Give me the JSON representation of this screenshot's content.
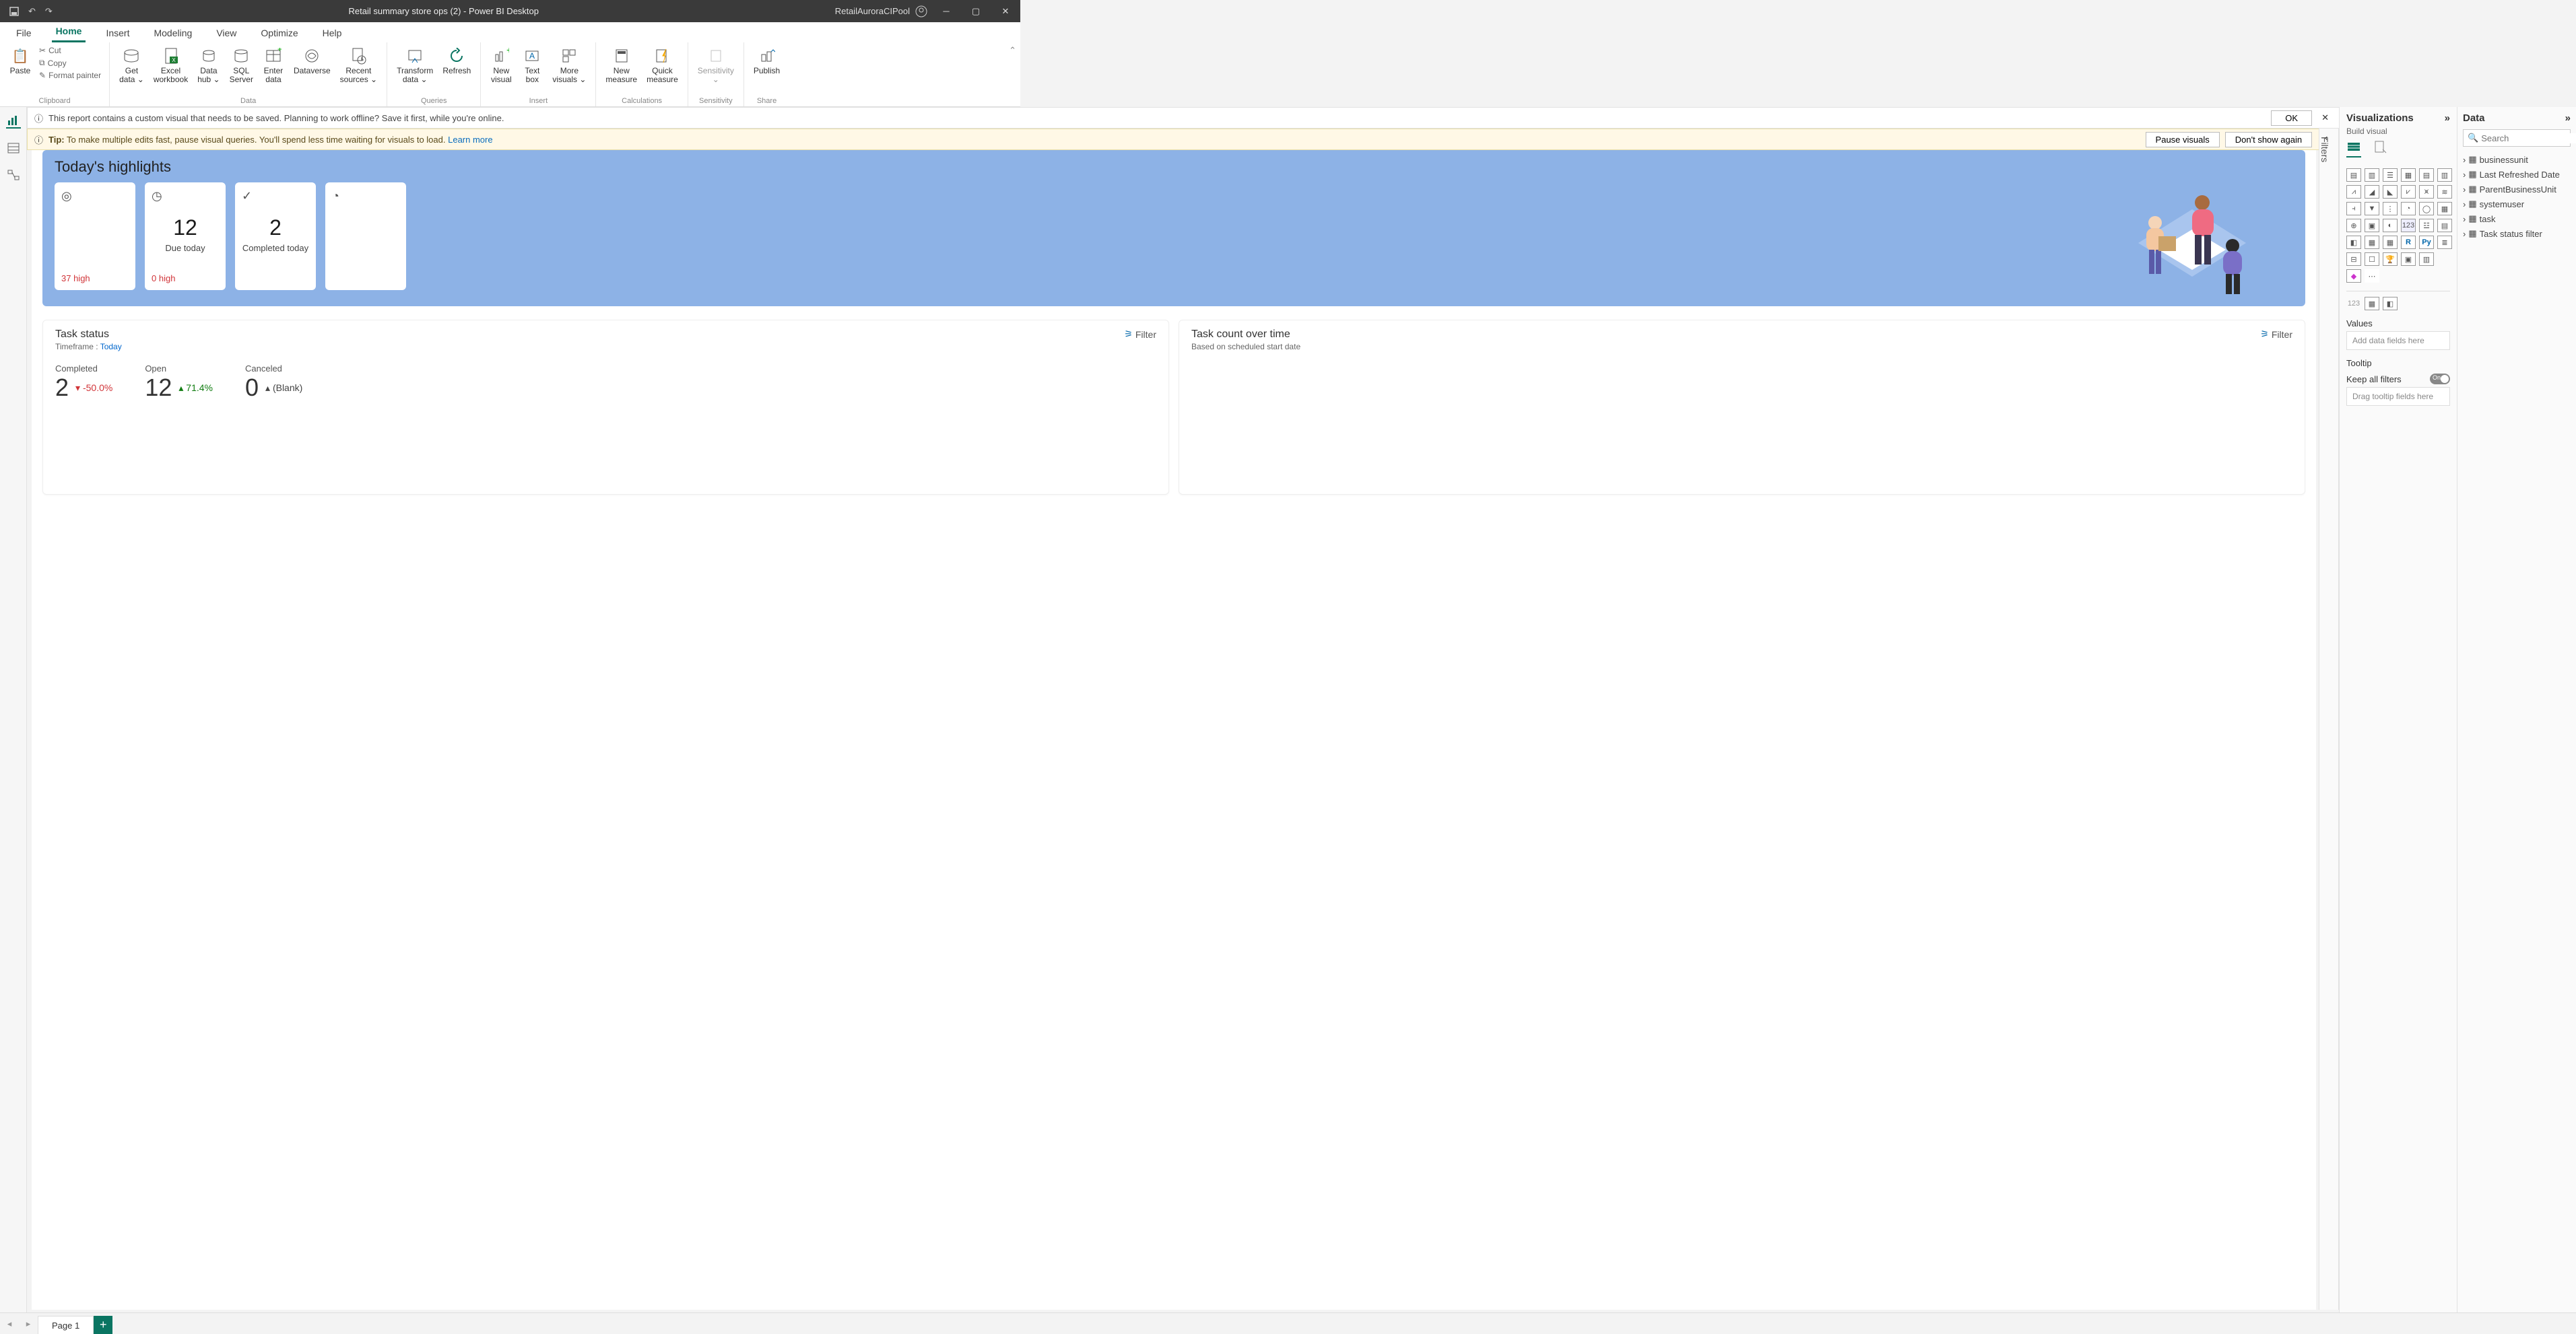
{
  "title": "Retail summary store ops (2) - Power BI Desktop",
  "username": "RetailAuroraCIPool",
  "menutabs": [
    "File",
    "Home",
    "Insert",
    "Modeling",
    "View",
    "Optimize",
    "Help"
  ],
  "activeMenu": 1,
  "ribbon": {
    "clipboard": {
      "label": "Clipboard",
      "paste": "Paste",
      "cut": "Cut",
      "copy": "Copy",
      "fmt": "Format painter"
    },
    "data": {
      "label": "Data",
      "b0": "Get\ndata ⌄",
      "b1": "Excel\nworkbook",
      "b2": "Data\nhub ⌄",
      "b3": "SQL\nServer",
      "b4": "Enter\ndata",
      "b5": "Dataverse",
      "b6": "Recent\nsources ⌄"
    },
    "queries": {
      "label": "Queries",
      "b0": "Transform\ndata ⌄",
      "b1": "Refresh"
    },
    "insert": {
      "label": "Insert",
      "b0": "New\nvisual",
      "b1": "Text\nbox",
      "b2": "More\nvisuals ⌄"
    },
    "calc": {
      "label": "Calculations",
      "b0": "New\nmeasure",
      "b1": "Quick\nmeasure"
    },
    "sens": {
      "label": "Sensitivity",
      "b0": "Sensitivity\n⌄"
    },
    "share": {
      "label": "Share",
      "b0": "Publish"
    }
  },
  "info1": {
    "msg": "This report contains a custom visual that needs to be saved. Planning to work offline? Save it first, while you're online.",
    "ok": "OK"
  },
  "info2": {
    "tip": "Tip:",
    "msg": " To make multiple edits fast, pause visual queries. You'll spend less time waiting for visuals to load.  ",
    "learn": "Learn more",
    "pause": "Pause visuals",
    "dont": "Don't show again"
  },
  "highlights": {
    "title": "Today's highlights",
    "cards": [
      {
        "icon": "◎",
        "val": "",
        "lbl": "",
        "foot": "37 high",
        "footcls": "r"
      },
      {
        "icon": "◷",
        "val": "12",
        "lbl": "Due today",
        "foot": "0 high",
        "footcls": "r"
      },
      {
        "icon": "✓",
        "val": "2",
        "lbl": "Completed today",
        "foot": "",
        "footcls": ""
      },
      {
        "icon": "◔",
        "val": "",
        "lbl": "",
        "foot": "",
        "footcls": ""
      }
    ]
  },
  "taskstatus": {
    "title": "Task status",
    "filter": "Filter",
    "tf_lbl": "Timeframe : ",
    "tf_val": "Today",
    "stats": [
      {
        "lbl": "Completed",
        "val": "2",
        "delta": "-50.0%",
        "dir": "down"
      },
      {
        "lbl": "Open",
        "val": "12",
        "delta": "71.4%",
        "dir": "up"
      },
      {
        "lbl": "Canceled",
        "val": "0",
        "delta": "(Blank)",
        "dir": "blank"
      }
    ]
  },
  "taskcount": {
    "title": "Task count over time",
    "sub": "Based on scheduled start date",
    "filter": "Filter"
  },
  "filters_label": "Filters",
  "viz": {
    "title": "Visualizations",
    "sub": "Build visual",
    "values_lbl": "Values",
    "values_ph": "Add data fields here",
    "tooltip_lbl": "Tooltip",
    "keepall": "Keep all filters",
    "on": "On",
    "tooltip_ph": "Drag tooltip fields here"
  },
  "data": {
    "title": "Data",
    "search_ph": "Search",
    "fields": [
      "businessunit",
      "Last Refreshed Date",
      "ParentBusinessUnit",
      "systemuser",
      "task",
      "Task status filter"
    ]
  },
  "page": {
    "name": "Page 1"
  }
}
